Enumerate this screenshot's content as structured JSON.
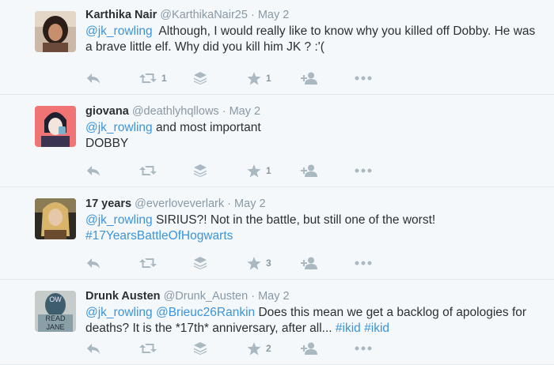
{
  "tweets": [
    {
      "fullname": "Karthika Nair",
      "handle": "@KarthikaNair25",
      "sep": "·",
      "time": "May 2",
      "mention": "@jk_rowling",
      "text": "  Although, I would really like to know why you killed off Dobby. He was a brave little elf. Why did you kill him JK ? :'(",
      "retweets": "1",
      "favorites": "1",
      "avatar_colors": [
        "#6b4a3a",
        "#2b1d18",
        "#c88f6e"
      ]
    },
    {
      "fullname": "giovana",
      "handle": "@deathlyhqllows",
      "sep": "·",
      "time": "May 2",
      "mention": "@jk_rowling",
      "text_line1": " and most important",
      "text_line2": "DOBBY",
      "retweets": "",
      "favorites": "1",
      "avatar_colors": [
        "#f07474",
        "#1f1f2e",
        "#7ab0c8"
      ]
    },
    {
      "fullname": "17 years",
      "handle": "@everloveverlark",
      "sep": "·",
      "time": "May 2",
      "mention": "@jk_rowling",
      "text": " SIRIUS?! Not in the battle, but still one of the worst!",
      "hashtag": "#17YearsBattleOfHogwarts",
      "retweets": "",
      "favorites": "3",
      "avatar_colors": [
        "#d8b56a",
        "#6b4b2e",
        "#2d2a24"
      ]
    },
    {
      "fullname": "Drunk Austen",
      "handle": "@Drunk_Austen",
      "sep": "·",
      "time": "May 2",
      "mention1": "@jk_rowling",
      "mention2": "@Brieuc26Rankin",
      "text": " Does this mean we get a backlog of apologies for deaths? It is the *17th* anniversary, after all... ",
      "hashtag1": "#ikid",
      "hashtag2": "#ikid",
      "retweets": "",
      "favorites": "2",
      "avatar_text": [
        "OW",
        "READ",
        "JANE"
      ],
      "avatar_colors": [
        "#c6ccc9",
        "#3e5e6e",
        "#8aa0a8"
      ]
    }
  ],
  "colors": {
    "link": "#3b94d9",
    "muted": "#8899a6",
    "icon": "#aab8c2",
    "background": "#f5f8fa",
    "border": "#e1e8ed"
  },
  "icons": [
    "reply-icon",
    "retweet-icon",
    "stack-icon",
    "star-icon",
    "follow-icon",
    "more-icon"
  ]
}
